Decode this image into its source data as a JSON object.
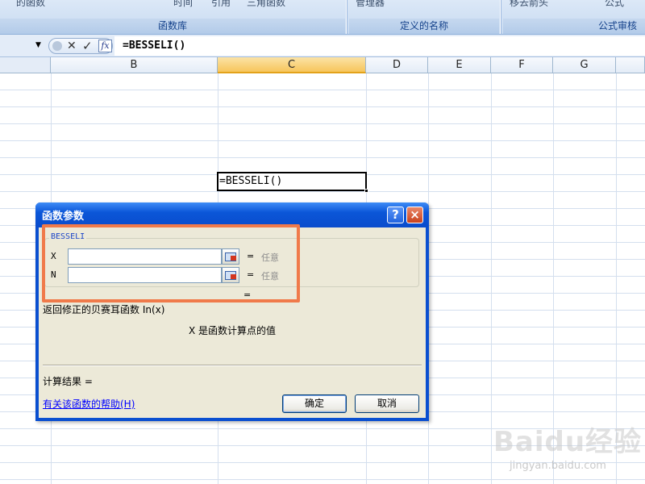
{
  "ribbon": {
    "commands": [
      "的函数",
      "时间",
      "引用",
      "三角函数",
      "管理器",
      "移去箭头",
      "公式"
    ],
    "groups": [
      "函数库",
      "定义的名称",
      "公式审核"
    ]
  },
  "formula_bar": {
    "fx_label": "fx",
    "formula": "=BESSELI()"
  },
  "columns": [
    "B",
    "C",
    "D",
    "E",
    "F",
    "G"
  ],
  "active_cell": {
    "content": "=BESSELI()"
  },
  "dialog": {
    "title": "函数参数",
    "help_button": "?",
    "close_button": "×",
    "function_name": "BESSELI",
    "args": [
      {
        "name": "X",
        "value": "",
        "result": "任意"
      },
      {
        "name": "N",
        "value": "",
        "result": "任意"
      }
    ],
    "equals": "=",
    "description": "返回修正的贝赛耳函数 In(x)",
    "arg_description": "X 是函数计算点的值",
    "calc_result_label": "计算结果 =",
    "help_link": "有关该函数的帮助(H)",
    "ok_label": "确定",
    "cancel_label": "取消"
  },
  "watermark": {
    "logo": "Baidu经验",
    "url": "jingyan.baidu.com"
  }
}
